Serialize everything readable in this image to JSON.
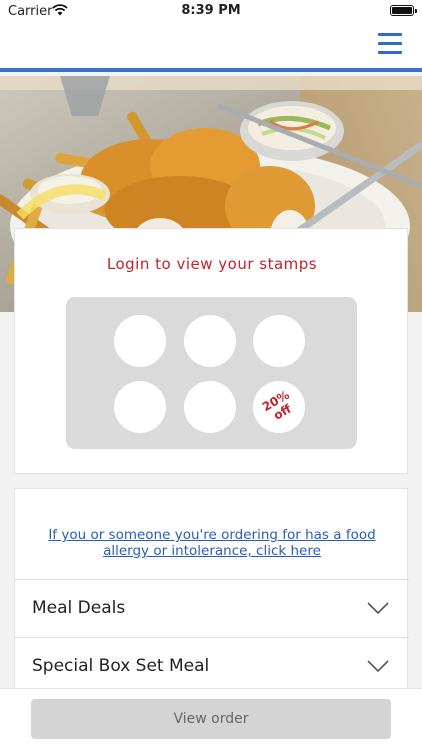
{
  "status_bar": {
    "carrier": "Carrier",
    "time": "8:39 PM"
  },
  "header": {
    "menu_icon": "hamburger-menu-icon",
    "accent_color": "#3a73c4"
  },
  "hero": {
    "image": "fish-and-chips-plate"
  },
  "stamps": {
    "login_text": "Login to view your stamps",
    "reward_label": "20%\noff",
    "reward_color": "#c4222b"
  },
  "menu": {
    "allergy_text": "If you or someone you're ordering for has a food allergy or intolerance, click here",
    "categories": [
      {
        "label": "Meal Deals",
        "icon": "chevron-down-icon"
      },
      {
        "label": "Special Box Set Meal",
        "icon": "chevron-down-icon"
      }
    ]
  },
  "footer": {
    "view_order_label": "View order"
  }
}
